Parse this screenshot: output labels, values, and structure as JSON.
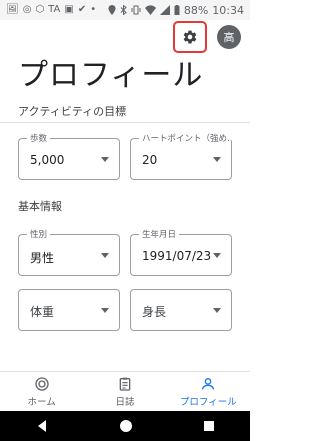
{
  "status": {
    "left_icons": [
      "🖼",
      "◎",
      "⬡",
      "TA",
      "▣",
      "✔",
      "•"
    ],
    "battery": "88%",
    "time": "10:34"
  },
  "header": {
    "avatar_initial": "高"
  },
  "page": {
    "title": "プロフィール"
  },
  "activity": {
    "section_title": "アクティビティの目標",
    "steps": {
      "label": "歩数",
      "value": "5,000"
    },
    "heart_points": {
      "label": "ハートポイント（強め…",
      "value": "20"
    }
  },
  "basic": {
    "section_title": "基本情報",
    "gender": {
      "label": "性別",
      "value": "男性"
    },
    "birthday": {
      "label": "生年月日",
      "value": "1991/07/23"
    },
    "weight": {
      "placeholder": "体重"
    },
    "height": {
      "placeholder": "身長"
    }
  },
  "bottom_nav": {
    "items": [
      {
        "label": "ホーム",
        "icon": "home-icon"
      },
      {
        "label": "日誌",
        "icon": "journal-icon"
      },
      {
        "label": "プロフィール",
        "icon": "profile-icon"
      }
    ]
  },
  "colors": {
    "accent": "#1a73e8",
    "highlight_box": "#e53935"
  }
}
